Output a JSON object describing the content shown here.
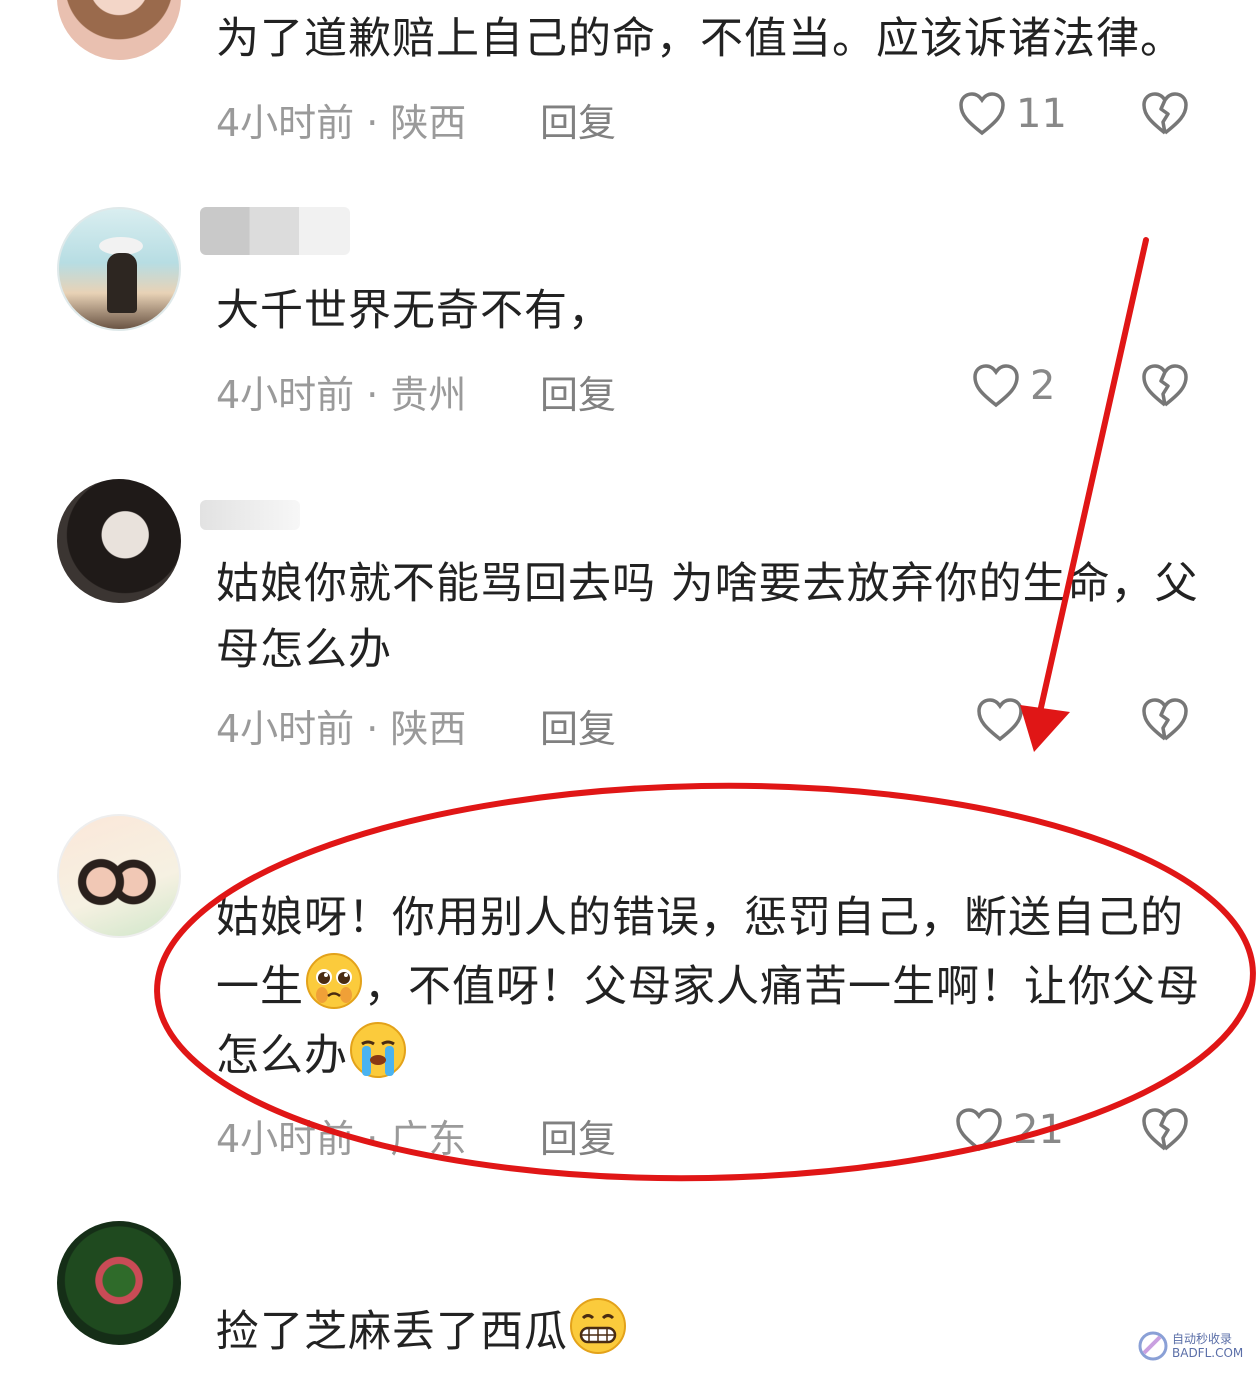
{
  "comments": [
    {
      "text": "为了道歉赔上自己的命，不值当。应该诉诸法律。",
      "time": "4小时前 · 陕西",
      "reply": "回复",
      "likes": "11"
    },
    {
      "text": "大千世界无奇不有，",
      "time": "4小时前 · 贵州",
      "reply": "回复",
      "likes": "2"
    },
    {
      "text": "姑娘你就不能骂回去吗 为啥要去放弃你的生命，父母怎么办",
      "time": "4小时前 · 陕西",
      "reply": "回复",
      "likes": ""
    },
    {
      "text_part1": "姑娘呀！你用别人的错误，惩罚自己，断送自己的一生",
      "text_part2": "，不值呀！父母家人痛苦一生啊！让你父母怎么办",
      "time": "4小时前 · 广东",
      "reply": "回复",
      "likes": "21"
    },
    {
      "text": "捡了芝麻丢了西瓜"
    }
  ],
  "icons": {
    "like": "heart-outline-icon",
    "dislike": "broken-heart-icon",
    "emoji_pleading": "pleading-face-emoji",
    "emoji_crying": "loudly-crying-face-emoji",
    "emoji_grin": "grinning-face-emoji"
  },
  "annotation": {
    "color": "#e01616"
  },
  "watermark": {
    "line1": "自动秒收录",
    "line2": "BADFL.COM"
  }
}
